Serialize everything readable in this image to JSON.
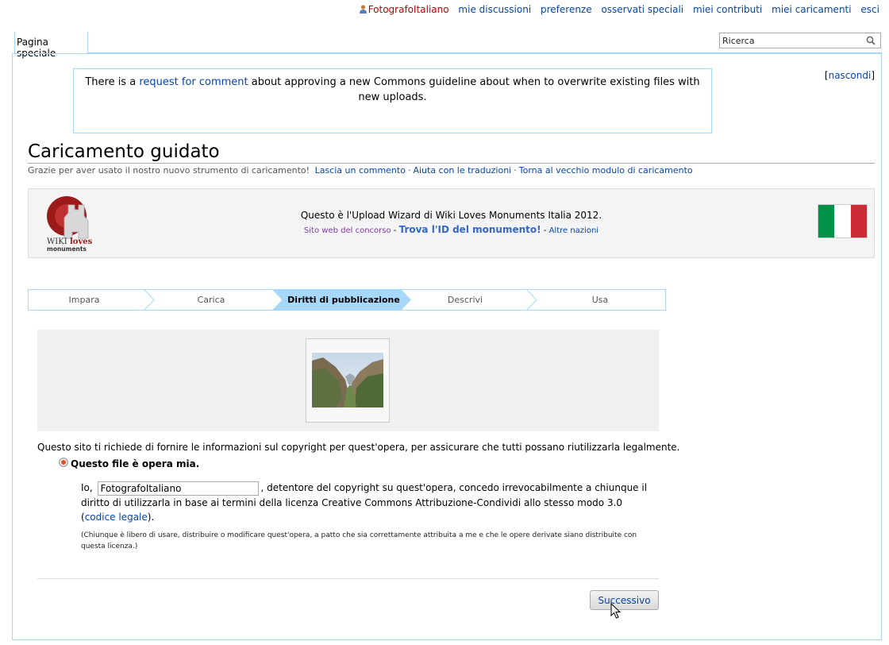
{
  "personal": {
    "user": "FotografoItaliano",
    "links": [
      "mie discussioni",
      "preferenze",
      "osservati speciali",
      "miei contributi",
      "miei caricamenti",
      "esci"
    ]
  },
  "tabs": {
    "special": "Pagina speciale"
  },
  "search": {
    "value": "Ricerca"
  },
  "notice": {
    "before": "There is a ",
    "link": "request for comment",
    "after": " about approving a new Commons guideline about when to overwrite existing files with new uploads.",
    "hide": "nascondi"
  },
  "page": {
    "title": "Caricamento guidato",
    "subtitle": "Grazie per aver usato il nostro nuovo strumento di caricamento!",
    "subtitle_links": [
      "Lascia un commento",
      "Aiuta con le traduzioni",
      "Torna al vecchio modulo di caricamento"
    ]
  },
  "banner": {
    "main": "Questo è l'Upload Wizard di Wiki Loves Monuments Italia 2012.",
    "site": "Sito web del concorso",
    "find_id": "Trova l'ID del monumento!",
    "other": "Altre nazioni",
    "logo_text_1": "WIKI",
    "logo_text_2": "loves",
    "logo_text_3": "monuments",
    "flag_colors": [
      "#009246",
      "#ffffff",
      "#ce2b37"
    ]
  },
  "steps": [
    "Impara",
    "Carica",
    "Diritti di pubblicazione",
    "Descrivi",
    "Usa"
  ],
  "deed": {
    "intro": "Questo sito ti richiede di fornire le informazioni sul copyright per quest'opera, per assicurare che tutti possano riutilizzarla legalmente.",
    "own_label": "Questo file è opera mia.",
    "io": "Io,",
    "author": "FotografoItaliano",
    "text": ", detentore del copyright su quest'opera, concedo irrevocabilmente a chiunque il diritto di utilizzarla in base ai termini della licenza Creative Commons Attribuzione-Condividi allo stesso modo 3.0 (",
    "legal_link": "codice legale",
    "text_end": ").",
    "note": "(Chiunque è libero di usare, distribuire o modificare quest'opera, a patto che sia correttamente attribuita a me e che le opere derivate siano distribuite con questa licenza.)"
  },
  "buttons": {
    "next": "Successivo"
  },
  "colors": {
    "link": "#0645ad",
    "border": "#a7d7f9",
    "user": "#ba0000"
  }
}
